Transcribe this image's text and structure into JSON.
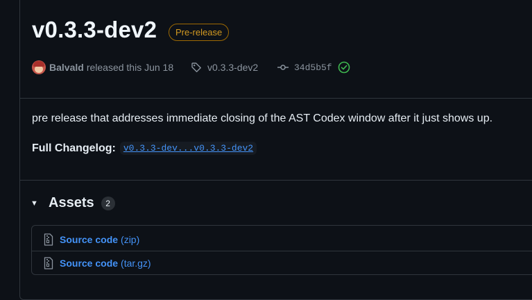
{
  "release": {
    "title": "v0.3.3-dev2",
    "badge": "Pre-release",
    "author": "Balvald",
    "released_text": "released this Jun 18",
    "tag": "v0.3.3-dev2",
    "commit": "34d5b5f",
    "verified_icon": "check-circle-icon"
  },
  "notes": {
    "body": "pre release that addresses immediate closing of the AST Codex window after it just shows up.",
    "changelog_label": "Full Changelog:",
    "changelog_link": "v0.3.3-dev...v0.3.3-dev2"
  },
  "assets": {
    "title": "Assets",
    "count": "2",
    "items": [
      {
        "name": "Source code",
        "ext": "(zip)",
        "icon": "file-zip-icon"
      },
      {
        "name": "Source code",
        "ext": "(tar.gz)",
        "icon": "file-zip-icon"
      }
    ]
  },
  "colors": {
    "background": "#0d1117",
    "border": "#30363d",
    "link": "#4493f8",
    "prerelease": "#d29922",
    "verified": "#3fb950"
  }
}
